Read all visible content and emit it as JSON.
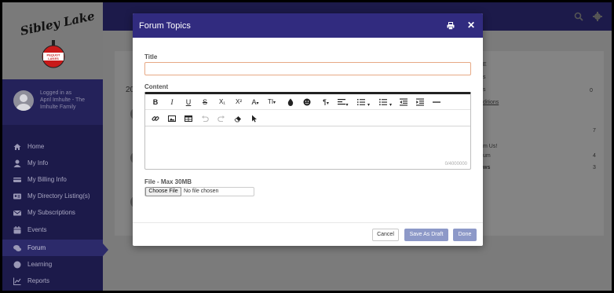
{
  "app": {
    "logo_text": "Sibley Lake",
    "logo_badge_top": "PEQUOT",
    "logo_badge_bottom": "LAKES"
  },
  "user": {
    "logged_in_label": "Logged in as",
    "name_line": "April Imhulte - The Imhulte Family"
  },
  "nav": {
    "items": [
      {
        "label": "Home",
        "icon": "home-icon"
      },
      {
        "label": "My Info",
        "icon": "user-icon"
      },
      {
        "label": "My Billing Info",
        "icon": "billing-icon"
      },
      {
        "label": "My Directory Listing(s)",
        "icon": "id-card-icon"
      },
      {
        "label": "My Subscriptions",
        "icon": "envelope-icon"
      },
      {
        "label": "Events",
        "icon": "calendar-icon"
      },
      {
        "label": "Forum",
        "icon": "comments-icon",
        "active": true
      },
      {
        "label": "Learning",
        "icon": "circle-icon"
      },
      {
        "label": "Reports",
        "icon": "chart-icon"
      }
    ]
  },
  "background": {
    "partial_year": "20",
    "right_col": [
      "E",
      "s",
      "s",
      "ditions",
      "m Us!",
      "um",
      "ws"
    ],
    "right_counts": [
      "0",
      "7",
      "4",
      "3"
    ]
  },
  "modal": {
    "title": "Forum Topics",
    "title_label": "Title",
    "title_value": "",
    "content_label": "Content",
    "char_count": "0/4000000",
    "file_label": "File - Max 30MB",
    "choose_file": "Choose File",
    "no_file": "No file chosen",
    "cancel": "Cancel",
    "save_draft": "Save As Draft",
    "done": "Done"
  },
  "toolbar": {
    "bold": "B",
    "italic": "I",
    "underline": "U",
    "strike": "S",
    "subscript": "X₁",
    "superscript": "X²",
    "font_color": "A",
    "font_size": "TI"
  },
  "colors": {
    "sidebar_bg": "#1c1a4a",
    "modal_header": "#312b7f",
    "primary_button": "#8d99c8",
    "title_input_border": "#e7a985"
  }
}
